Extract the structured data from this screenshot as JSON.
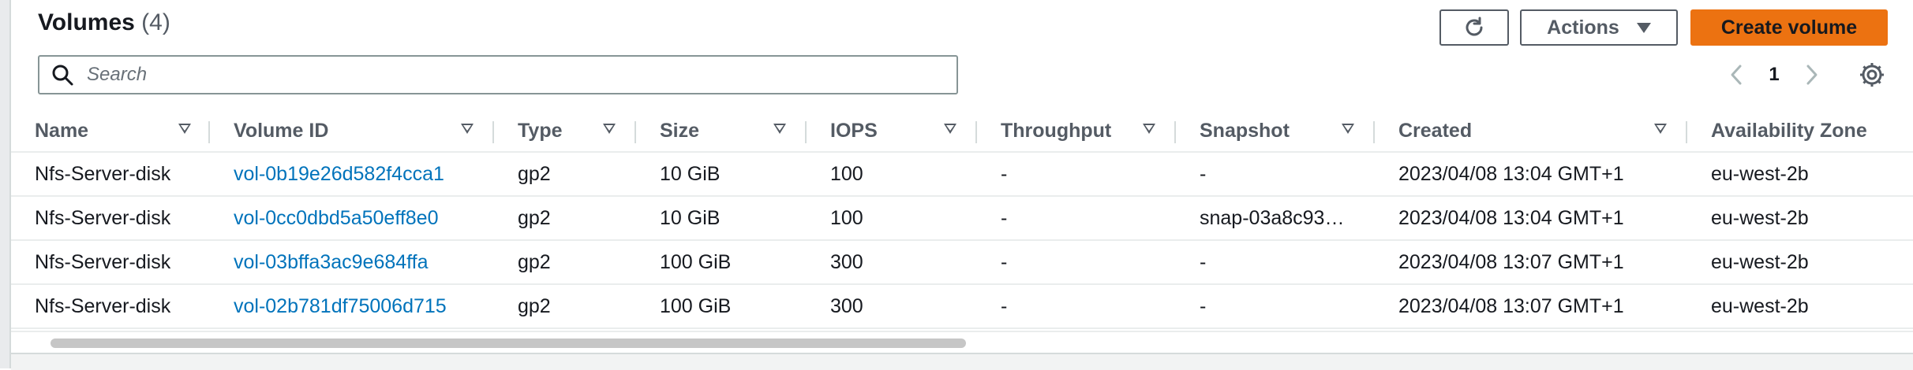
{
  "header": {
    "title": "Volumes",
    "count": "(4)"
  },
  "toolbar": {
    "refresh_icon": "refresh-icon",
    "actions_label": "Actions",
    "create_label": "Create volume",
    "create_color": "#ec7211"
  },
  "search": {
    "placeholder": "Search",
    "value": ""
  },
  "pagination": {
    "current_page": "1",
    "prev_icon": "chevron-left-icon",
    "next_icon": "chevron-right-icon"
  },
  "table": {
    "columns": [
      "Name",
      "Volume ID",
      "Type",
      "Size",
      "IOPS",
      "Throughput",
      "Snapshot",
      "Created",
      "Availability Zone"
    ],
    "rows": [
      [
        "Nfs-Server-disk",
        "vol-0b19e26d582f4cca1",
        "gp2",
        "10 GiB",
        "100",
        "-",
        "-",
        "2023/04/08 13:04 GMT+1",
        "eu-west-2b"
      ],
      [
        "Nfs-Server-disk",
        "vol-0cc0dbd5a50eff8e0",
        "gp2",
        "10 GiB",
        "100",
        "-",
        "snap-03a8c93…",
        "2023/04/08 13:04 GMT+1",
        "eu-west-2b"
      ],
      [
        "Nfs-Server-disk",
        "vol-03bffa3ac9e684ffa",
        "gp2",
        "100 GiB",
        "300",
        "-",
        "-",
        "2023/04/08 13:07 GMT+1",
        "eu-west-2b"
      ],
      [
        "Nfs-Server-disk",
        "vol-02b781df75006d715",
        "gp2",
        "100 GiB",
        "300",
        "-",
        "-",
        "2023/04/08 13:07 GMT+1",
        "eu-west-2b"
      ]
    ]
  },
  "colors": {
    "link": "#0073bb",
    "accent": "#ec7211",
    "text": "#16191f",
    "muted": "#545b64"
  }
}
